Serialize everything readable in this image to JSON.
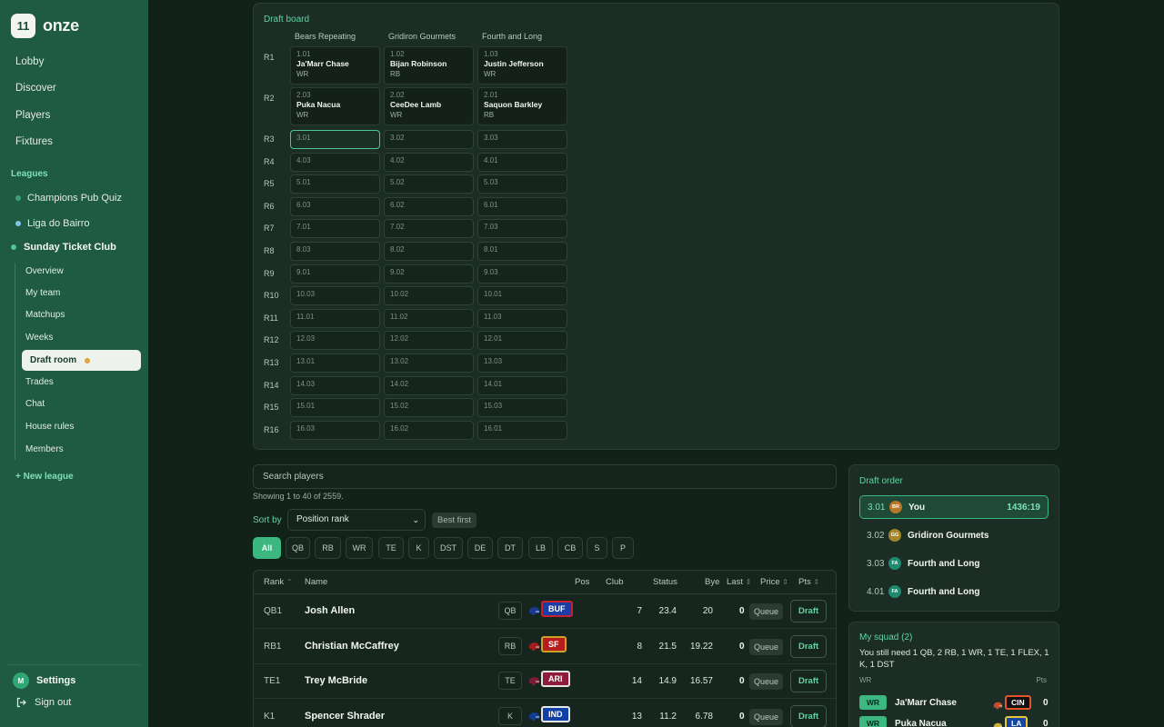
{
  "app": {
    "logo_mark": "11",
    "name": "onze"
  },
  "nav": {
    "lobby": "Lobby",
    "discover": "Discover",
    "players": "Players",
    "fixtures": "Fixtures"
  },
  "leagues": {
    "heading": "Leagues",
    "items": [
      {
        "label": "Champions Pub Quiz",
        "color": "#3aa276"
      },
      {
        "label": "Liga do Bairro",
        "color": "#7cc7e8"
      }
    ],
    "active": {
      "label": "Sunday Ticket Club",
      "sub": [
        "Overview",
        "My team",
        "Matchups",
        "Weeks",
        "Draft room",
        "Trades",
        "Chat",
        "House rules",
        "Members"
      ]
    },
    "new_league": "+ New league"
  },
  "account": {
    "avatar_initial": "M",
    "settings": "Settings",
    "sign_out": "Sign out"
  },
  "board": {
    "title": "Draft board",
    "teams": [
      "Bears Repeating",
      "Gridiron Gourmets",
      "Fourth and Long"
    ],
    "rounds": [
      {
        "label": "R1",
        "picks": [
          {
            "no": "1.01",
            "name": "Ja'Marr Chase",
            "pos": "WR"
          },
          {
            "no": "1.02",
            "name": "Bijan Robinson",
            "pos": "RB"
          },
          {
            "no": "1.03",
            "name": "Justin Jefferson",
            "pos": "WR"
          }
        ]
      },
      {
        "label": "R2",
        "picks": [
          {
            "no": "2.03",
            "name": "Puka Nacua",
            "pos": "WR"
          },
          {
            "no": "2.02",
            "name": "CeeDee Lamb",
            "pos": "WR"
          },
          {
            "no": "2.01",
            "name": "Saquon Barkley",
            "pos": "RB"
          }
        ]
      },
      {
        "label": "R3",
        "picks": [
          {
            "no": "3.01"
          },
          {
            "no": "3.02"
          },
          {
            "no": "3.03"
          }
        ]
      },
      {
        "label": "R4",
        "picks": [
          {
            "no": "4.03"
          },
          {
            "no": "4.02"
          },
          {
            "no": "4.01"
          }
        ]
      },
      {
        "label": "R5",
        "picks": [
          {
            "no": "5.01"
          },
          {
            "no": "5.02"
          },
          {
            "no": "5.03"
          }
        ]
      },
      {
        "label": "R6",
        "picks": [
          {
            "no": "6.03"
          },
          {
            "no": "6.02"
          },
          {
            "no": "6.01"
          }
        ]
      },
      {
        "label": "R7",
        "picks": [
          {
            "no": "7.01"
          },
          {
            "no": "7.02"
          },
          {
            "no": "7.03"
          }
        ]
      },
      {
        "label": "R8",
        "picks": [
          {
            "no": "8.03"
          },
          {
            "no": "8.02"
          },
          {
            "no": "8.01"
          }
        ]
      },
      {
        "label": "R9",
        "picks": [
          {
            "no": "9.01"
          },
          {
            "no": "9.02"
          },
          {
            "no": "9.03"
          }
        ]
      },
      {
        "label": "R10",
        "picks": [
          {
            "no": "10.03"
          },
          {
            "no": "10.02"
          },
          {
            "no": "10.01"
          }
        ]
      },
      {
        "label": "R11",
        "picks": [
          {
            "no": "11.01"
          },
          {
            "no": "11.02"
          },
          {
            "no": "11.03"
          }
        ]
      },
      {
        "label": "R12",
        "picks": [
          {
            "no": "12.03"
          },
          {
            "no": "12.02"
          },
          {
            "no": "12.01"
          }
        ]
      },
      {
        "label": "R13",
        "picks": [
          {
            "no": "13.01"
          },
          {
            "no": "13.02"
          },
          {
            "no": "13.03"
          }
        ]
      },
      {
        "label": "R14",
        "picks": [
          {
            "no": "14.03"
          },
          {
            "no": "14.02"
          },
          {
            "no": "14.01"
          }
        ]
      },
      {
        "label": "R15",
        "picks": [
          {
            "no": "15.01"
          },
          {
            "no": "15.02"
          },
          {
            "no": "15.03"
          }
        ]
      },
      {
        "label": "R16",
        "picks": [
          {
            "no": "16.03"
          },
          {
            "no": "16.02"
          },
          {
            "no": "16.01"
          }
        ]
      }
    ]
  },
  "search": {
    "placeholder": "Search players"
  },
  "showing": "Showing 1 to 40 of 2559.",
  "sort": {
    "label": "Sort by",
    "selected": "Position rank",
    "best_first": "Best first"
  },
  "positions": [
    "All",
    "QB",
    "RB",
    "WR",
    "TE",
    "K",
    "DST",
    "DE",
    "DT",
    "LB",
    "CB",
    "S",
    "P"
  ],
  "table": {
    "headers": {
      "rank": "Rank",
      "name": "Name",
      "pos": "Pos",
      "club": "Club",
      "status": "Status",
      "bye": "Bye",
      "last": "Last",
      "price": "Price",
      "pts": "Pts"
    },
    "queue_label": "Queue",
    "draft_label": "Draft",
    "rows": [
      {
        "rank": "QB1",
        "name": "Josh Allen",
        "pos": "QB",
        "club": "BUF",
        "club_color": "#1b3ea6",
        "club_border": "#c8202f",
        "bye": "7",
        "last": "23.4",
        "price": "20",
        "pts": "0"
      },
      {
        "rank": "RB1",
        "name": "Christian McCaffrey",
        "pos": "RB",
        "club": "SF",
        "club_color": "#b71c1c",
        "club_border": "#c9a227",
        "bye": "8",
        "last": "21.5",
        "price": "19.22",
        "pts": "0"
      },
      {
        "rank": "TE1",
        "name": "Trey McBride",
        "pos": "TE",
        "club": "ARI",
        "club_color": "#8e1b3a",
        "club_border": "#e2e2e2",
        "bye": "14",
        "last": "14.9",
        "price": "16.57",
        "pts": "0"
      },
      {
        "rank": "K1",
        "name": "Spencer Shrader",
        "pos": "K",
        "club": "IND",
        "club_color": "#1241a6",
        "club_border": "#e8e8e8",
        "bye": "13",
        "last": "11.2",
        "price": "6.78",
        "pts": "0"
      }
    ]
  },
  "draft_order": {
    "title": "Draft order",
    "rows": [
      {
        "pick": "3.01",
        "initials": "BR",
        "badge_color": "#b5782a",
        "name": "You",
        "timer": "1436:19"
      },
      {
        "pick": "3.02",
        "initials": "GG",
        "badge_color": "#a6862b",
        "name": "Gridiron Gourmets"
      },
      {
        "pick": "3.03",
        "initials": "FA",
        "badge_color": "#1f8a70",
        "name": "Fourth and Long"
      },
      {
        "pick": "4.01",
        "initials": "FA",
        "badge_color": "#1f8a70",
        "name": "Fourth and Long"
      }
    ]
  },
  "squad": {
    "title": "My squad (2)",
    "need": "You still need 1 QB, 2 RB, 1 WR, 1 TE, 1 FLEX, 1 K, 1 DST",
    "col_pos": "WR",
    "col_pts": "Pts",
    "rows": [
      {
        "pos": "WR",
        "name": "Ja'Marr Chase",
        "club": "CIN",
        "club_color": "#111111",
        "club_border": "#e2542a",
        "pts": "0"
      },
      {
        "pos": "WR",
        "name": "Puka Nacua",
        "club": "LA",
        "club_color": "#1746a2",
        "club_border": "#e8c53a",
        "pts": "0"
      }
    ]
  }
}
